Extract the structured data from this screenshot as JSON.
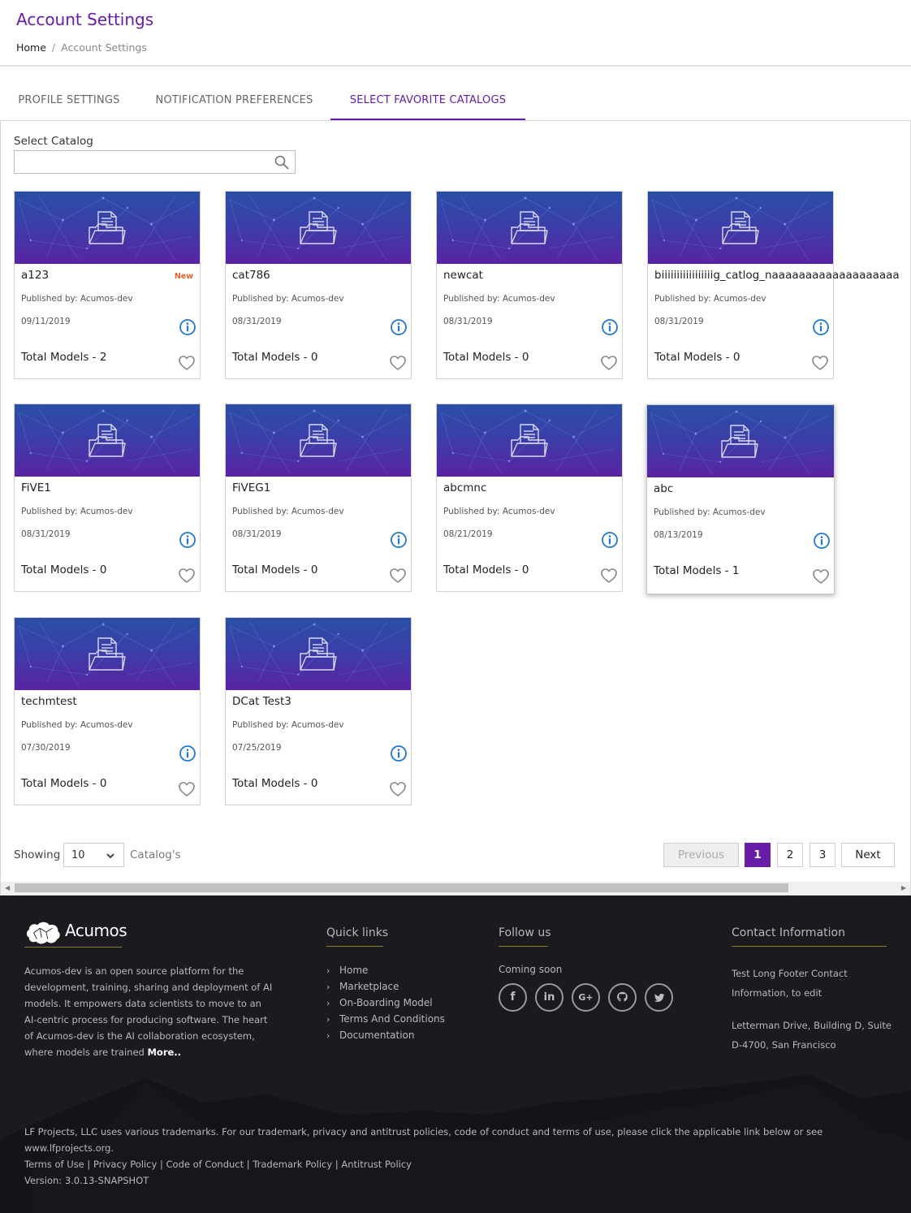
{
  "header": {
    "title": "Account Settings",
    "breadcrumb": {
      "home": "Home",
      "separator": "/",
      "current": "Account Settings"
    }
  },
  "tabs": [
    {
      "label": "PROFILE SETTINGS",
      "active": false
    },
    {
      "label": "NOTIFICATION PREFERENCES",
      "active": false
    },
    {
      "label": "SELECT FAVORITE CATALOGS",
      "active": true
    }
  ],
  "search": {
    "label": "Select Catalog",
    "value": "",
    "placeholder": ""
  },
  "cards": [
    {
      "name": "a123",
      "badge": "New",
      "published": "Published by: Acumos-dev",
      "date": "09/11/2019",
      "total": "Total Models - 2"
    },
    {
      "name": "cat786",
      "badge": "",
      "published": "Published by: Acumos-dev",
      "date": "08/31/2019",
      "total": "Total Models - 0"
    },
    {
      "name": "newcat",
      "badge": "",
      "published": "Published by: Acumos-dev",
      "date": "08/31/2019",
      "total": "Total Models - 0"
    },
    {
      "name": "biiiiiiiiiiiiiiiiig_catlog_naaaaaaaaaaaaaaaaaaa",
      "badge": "",
      "published": "Published by: Acumos-dev",
      "date": "08/31/2019",
      "total": "Total Models - 0"
    },
    {
      "name": "FiVE1",
      "badge": "",
      "published": "Published by: Acumos-dev",
      "date": "08/31/2019",
      "total": "Total Models - 0"
    },
    {
      "name": "FiVEG1",
      "badge": "",
      "published": "Published by: Acumos-dev",
      "date": "08/31/2019",
      "total": "Total Models - 0"
    },
    {
      "name": "abcmnc",
      "badge": "",
      "published": "Published by: Acumos-dev",
      "date": "08/21/2019",
      "total": "Total Models - 0"
    },
    {
      "name": "abc",
      "badge": "",
      "published": "Published by: Acumos-dev",
      "date": "08/13/2019",
      "total": "Total Models - 1"
    },
    {
      "name": "techmtest",
      "badge": "",
      "published": "Published by: Acumos-dev",
      "date": "07/30/2019",
      "total": "Total Models - 0"
    },
    {
      "name": "DCat Test3",
      "badge": "",
      "published": "Published by: Acumos-dev",
      "date": "07/25/2019",
      "total": "Total Models - 0"
    }
  ],
  "pagination": {
    "showing_label": "Showing",
    "page_size": "10",
    "items_label": "Catalog's",
    "previous": "Previous",
    "pages": [
      "1",
      "2",
      "3"
    ],
    "current_page": "1",
    "next": "Next"
  },
  "footer": {
    "logo_text": "Acumos",
    "description": "Acumos-dev is an open source platform for the development, training, sharing and deployment of AI models. It empowers data scientists to move to an AI-centric process for producing software. The heart of Acumos-dev is the AI collaboration ecosystem, where models are trained",
    "more": "More..",
    "quick_links_heading": "Quick links",
    "quick_links": [
      "Home",
      "Marketplace",
      "On-Boarding Model",
      "Terms And Conditions",
      "Documentation"
    ],
    "follow_heading": "Follow us",
    "coming_soon": "Coming soon",
    "social": [
      "facebook-icon",
      "linkedin-icon",
      "google-plus-icon",
      "github-icon",
      "twitter-icon"
    ],
    "contact_heading": "Contact Information",
    "contact_line1": "Test Long Footer Contact Information, to edit",
    "contact_line2": "Letterman Drive, Building D, Suite D-4700, San Francisco",
    "legal": "LF Projects, LLC uses various trademarks. For our trademark, privacy and antitrust policies, code of conduct and terms of use, please click the applicable link below or see www.lfprojects.org.",
    "legal_links": [
      "Terms of Use",
      "Privacy Policy",
      "Code of Conduct",
      "Trademark Policy",
      "Antitrust Policy"
    ],
    "version": "Version: 3.0.13-SNAPSHOT"
  },
  "colors": {
    "accent": "#681da8",
    "new_badge": "#e8632b",
    "info_icon": "#1f78d1",
    "footer_bg": "#1b1a1f"
  }
}
